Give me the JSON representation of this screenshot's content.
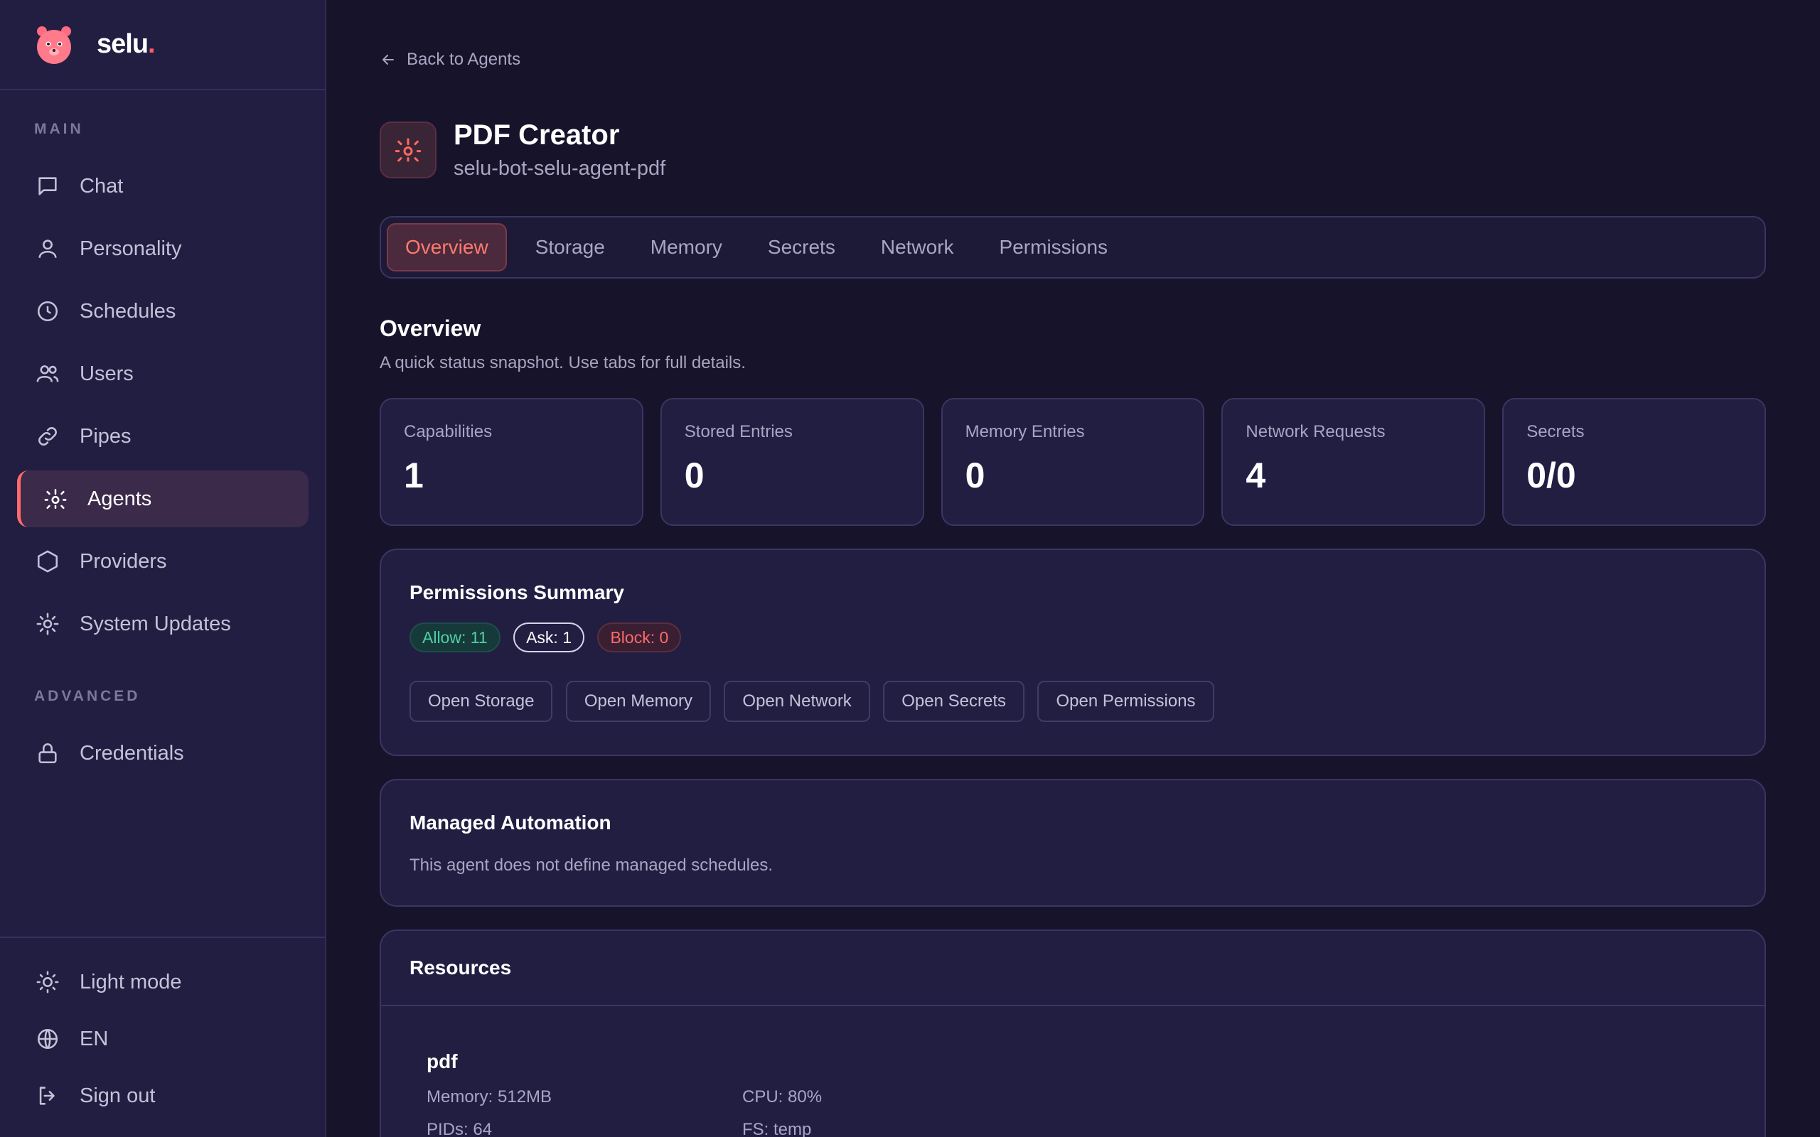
{
  "brand": {
    "name": "selu",
    "dot": "."
  },
  "sidebar": {
    "main_label": "MAIN",
    "advanced_label": "ADVANCED",
    "items": [
      {
        "label": "Chat",
        "icon": "chat-icon"
      },
      {
        "label": "Personality",
        "icon": "person-icon"
      },
      {
        "label": "Schedules",
        "icon": "clock-icon"
      },
      {
        "label": "Users",
        "icon": "users-icon"
      },
      {
        "label": "Pipes",
        "icon": "link-icon"
      },
      {
        "label": "Agents",
        "icon": "agent-icon",
        "active": true
      },
      {
        "label": "Providers",
        "icon": "hexagon-icon"
      },
      {
        "label": "System Updates",
        "icon": "sun-icon"
      }
    ],
    "advanced_items": [
      {
        "label": "Credentials",
        "icon": "lock-icon"
      }
    ],
    "bottom": {
      "theme": "Light mode",
      "language": "EN",
      "signout": "Sign out"
    }
  },
  "header": {
    "back": "Back to Agents",
    "title": "PDF Creator",
    "subtitle": "selu-bot-selu-agent-pdf"
  },
  "tabs": [
    "Overview",
    "Storage",
    "Memory",
    "Secrets",
    "Network",
    "Permissions"
  ],
  "overview": {
    "title": "Overview",
    "subtitle": "A quick status snapshot. Use tabs for full details.",
    "stats": [
      {
        "label": "Capabilities",
        "value": "1"
      },
      {
        "label": "Stored Entries",
        "value": "0"
      },
      {
        "label": "Memory Entries",
        "value": "0"
      },
      {
        "label": "Network Requests",
        "value": "4"
      },
      {
        "label": "Secrets",
        "value": "0/0"
      }
    ]
  },
  "permissions": {
    "title": "Permissions Summary",
    "allow": "Allow: 11",
    "ask": "Ask: 1",
    "block": "Block: 0",
    "buttons": [
      "Open Storage",
      "Open Memory",
      "Open Network",
      "Open Secrets",
      "Open Permissions"
    ]
  },
  "automation": {
    "title": "Managed Automation",
    "text": "This agent does not define managed schedules."
  },
  "resources": {
    "title": "Resources",
    "name": "pdf",
    "memory": "Memory: 512MB",
    "cpu": "CPU: 80%",
    "pids": "PIDs: 64",
    "fs": "FS: temp"
  },
  "colors": {
    "accent": "#ff6b6b",
    "background": "#16132b",
    "sidebar": "#221e42",
    "allow": "#4fd1a5"
  }
}
